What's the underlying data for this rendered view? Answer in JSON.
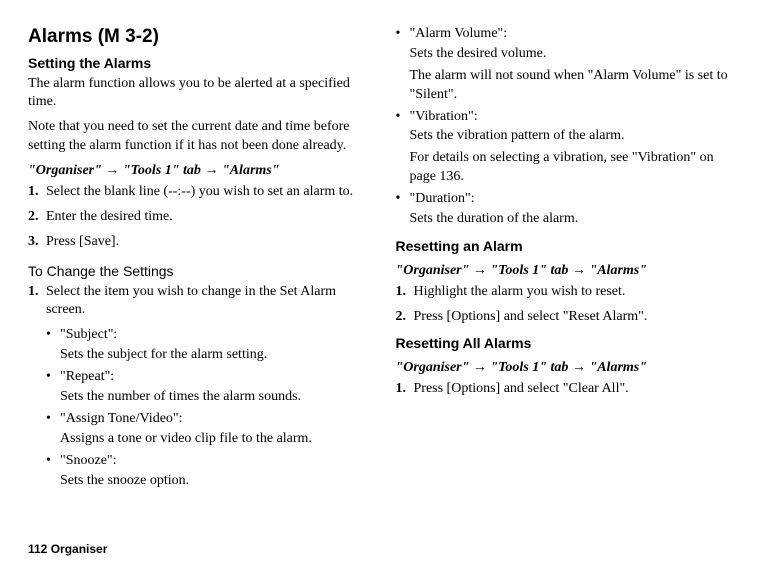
{
  "title": "Alarms (M 3-2)",
  "section_setting_heading": "Setting the Alarms",
  "para_intro": "The alarm function allows you to be alerted at a specified time.",
  "para_note": "Note that you need to set the current date and time before setting the alarm function if it has not been done already.",
  "nav_path_prefix": "\"Organiser\" ",
  "nav_path_mid1": " \"Tools 1\" tab ",
  "nav_path_suffix": " \"Alarms\"",
  "arrow": "→",
  "steps_setting": {
    "s1_num": "1.",
    "s1_text": "Select the blank line (--:--) you wish to set an alarm to.",
    "s2_num": "2.",
    "s2_text": "Enter the desired time.",
    "s3_num": "3.",
    "s3_text": "Press [Save]."
  },
  "change_heading": "To Change the Settings",
  "change_step_num": "1.",
  "change_step_text": "Select the item you wish to change in the Set Alarm screen.",
  "bullet": "•",
  "settings": {
    "subject_label": "\"Subject\":",
    "subject_desc": "Sets the subject for the alarm setting.",
    "repeat_label": "\"Repeat\":",
    "repeat_desc": "Sets the number of times the alarm sounds.",
    "tone_label": "\"Assign Tone/Video\":",
    "tone_desc": "Assigns a tone or video clip file to the alarm.",
    "snooze_label": "\"Snooze\":",
    "snooze_desc": "Sets the snooze option.",
    "volume_label": "\"Alarm Volume\":",
    "volume_desc1": "Sets the desired volume.",
    "volume_desc2": "The alarm will not sound when \"Alarm Volume\" is set to \"Silent\".",
    "vibration_label": "\"Vibration\":",
    "vibration_desc1": "Sets the vibration pattern of the alarm.",
    "vibration_desc2": "For details on selecting a vibration, see \"Vibration\" on page 136.",
    "duration_label": "\"Duration\":",
    "duration_desc": "Sets the duration of the alarm."
  },
  "reset_heading": "Resetting an Alarm",
  "reset_step1_num": "1.",
  "reset_step1_text": "Highlight the alarm you wish to reset.",
  "reset_step2_num": "2.",
  "reset_step2_text": "Press [Options] and select \"Reset Alarm\".",
  "reset_all_heading": "Resetting All Alarms",
  "reset_all_step_num": "1.",
  "reset_all_step_text": "Press [Options] and select \"Clear All\".",
  "footer": "112   Organiser"
}
